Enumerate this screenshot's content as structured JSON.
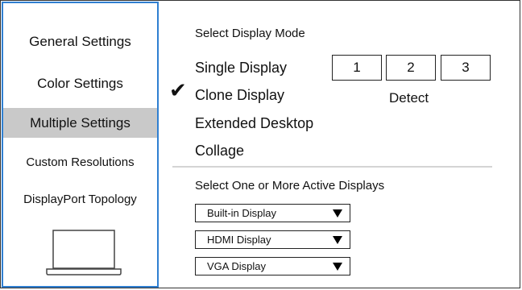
{
  "sidebar": {
    "items": [
      {
        "label": "General Settings",
        "active": false
      },
      {
        "label": "Color Settings",
        "active": false
      },
      {
        "label": "Multiple Settings",
        "active": true
      },
      {
        "label": "Custom Resolutions",
        "active": false
      },
      {
        "label": "DisplayPort Topology",
        "active": false
      }
    ],
    "device_icon": "laptop-icon"
  },
  "display_mode": {
    "heading": "Select Display Mode",
    "options": [
      {
        "label": "Single Display",
        "selected": false
      },
      {
        "label": "Clone Display",
        "selected": true
      },
      {
        "label": "Extended Desktop",
        "selected": false
      },
      {
        "label": "Collage",
        "selected": false
      }
    ],
    "checkmark": "✔"
  },
  "displays": {
    "numbers": [
      "1",
      "2",
      "3"
    ],
    "detect_label": "Detect"
  },
  "active_displays": {
    "heading": "Select One or More Active Displays",
    "dropdowns": [
      {
        "value": "Built-in Display"
      },
      {
        "value": "HDMI Display"
      },
      {
        "value": "VGA Display"
      }
    ]
  },
  "colors": {
    "sidebar_border": "#2f7fd1",
    "active_item_bg": "#c9c9c9",
    "divider": "#d4d4d4"
  }
}
